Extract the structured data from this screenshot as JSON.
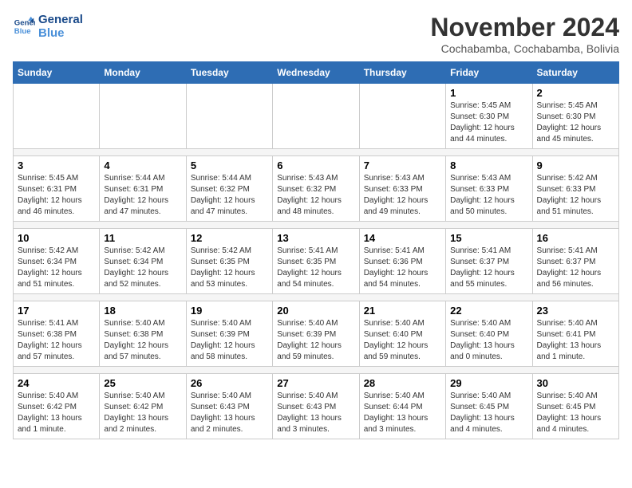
{
  "logo": {
    "line1": "General",
    "line2": "Blue"
  },
  "title": "November 2024",
  "subtitle": "Cochabamba, Cochabamba, Bolivia",
  "weekdays": [
    "Sunday",
    "Monday",
    "Tuesday",
    "Wednesday",
    "Thursday",
    "Friday",
    "Saturday"
  ],
  "weeks": [
    [
      {
        "day": "",
        "info": ""
      },
      {
        "day": "",
        "info": ""
      },
      {
        "day": "",
        "info": ""
      },
      {
        "day": "",
        "info": ""
      },
      {
        "day": "",
        "info": ""
      },
      {
        "day": "1",
        "info": "Sunrise: 5:45 AM\nSunset: 6:30 PM\nDaylight: 12 hours\nand 44 minutes."
      },
      {
        "day": "2",
        "info": "Sunrise: 5:45 AM\nSunset: 6:30 PM\nDaylight: 12 hours\nand 45 minutes."
      }
    ],
    [
      {
        "day": "3",
        "info": "Sunrise: 5:45 AM\nSunset: 6:31 PM\nDaylight: 12 hours\nand 46 minutes."
      },
      {
        "day": "4",
        "info": "Sunrise: 5:44 AM\nSunset: 6:31 PM\nDaylight: 12 hours\nand 47 minutes."
      },
      {
        "day": "5",
        "info": "Sunrise: 5:44 AM\nSunset: 6:32 PM\nDaylight: 12 hours\nand 47 minutes."
      },
      {
        "day": "6",
        "info": "Sunrise: 5:43 AM\nSunset: 6:32 PM\nDaylight: 12 hours\nand 48 minutes."
      },
      {
        "day": "7",
        "info": "Sunrise: 5:43 AM\nSunset: 6:33 PM\nDaylight: 12 hours\nand 49 minutes."
      },
      {
        "day": "8",
        "info": "Sunrise: 5:43 AM\nSunset: 6:33 PM\nDaylight: 12 hours\nand 50 minutes."
      },
      {
        "day": "9",
        "info": "Sunrise: 5:42 AM\nSunset: 6:33 PM\nDaylight: 12 hours\nand 51 minutes."
      }
    ],
    [
      {
        "day": "10",
        "info": "Sunrise: 5:42 AM\nSunset: 6:34 PM\nDaylight: 12 hours\nand 51 minutes."
      },
      {
        "day": "11",
        "info": "Sunrise: 5:42 AM\nSunset: 6:34 PM\nDaylight: 12 hours\nand 52 minutes."
      },
      {
        "day": "12",
        "info": "Sunrise: 5:42 AM\nSunset: 6:35 PM\nDaylight: 12 hours\nand 53 minutes."
      },
      {
        "day": "13",
        "info": "Sunrise: 5:41 AM\nSunset: 6:35 PM\nDaylight: 12 hours\nand 54 minutes."
      },
      {
        "day": "14",
        "info": "Sunrise: 5:41 AM\nSunset: 6:36 PM\nDaylight: 12 hours\nand 54 minutes."
      },
      {
        "day": "15",
        "info": "Sunrise: 5:41 AM\nSunset: 6:37 PM\nDaylight: 12 hours\nand 55 minutes."
      },
      {
        "day": "16",
        "info": "Sunrise: 5:41 AM\nSunset: 6:37 PM\nDaylight: 12 hours\nand 56 minutes."
      }
    ],
    [
      {
        "day": "17",
        "info": "Sunrise: 5:41 AM\nSunset: 6:38 PM\nDaylight: 12 hours\nand 57 minutes."
      },
      {
        "day": "18",
        "info": "Sunrise: 5:40 AM\nSunset: 6:38 PM\nDaylight: 12 hours\nand 57 minutes."
      },
      {
        "day": "19",
        "info": "Sunrise: 5:40 AM\nSunset: 6:39 PM\nDaylight: 12 hours\nand 58 minutes."
      },
      {
        "day": "20",
        "info": "Sunrise: 5:40 AM\nSunset: 6:39 PM\nDaylight: 12 hours\nand 59 minutes."
      },
      {
        "day": "21",
        "info": "Sunrise: 5:40 AM\nSunset: 6:40 PM\nDaylight: 12 hours\nand 59 minutes."
      },
      {
        "day": "22",
        "info": "Sunrise: 5:40 AM\nSunset: 6:40 PM\nDaylight: 13 hours\nand 0 minutes."
      },
      {
        "day": "23",
        "info": "Sunrise: 5:40 AM\nSunset: 6:41 PM\nDaylight: 13 hours\nand 1 minute."
      }
    ],
    [
      {
        "day": "24",
        "info": "Sunrise: 5:40 AM\nSunset: 6:42 PM\nDaylight: 13 hours\nand 1 minute."
      },
      {
        "day": "25",
        "info": "Sunrise: 5:40 AM\nSunset: 6:42 PM\nDaylight: 13 hours\nand 2 minutes."
      },
      {
        "day": "26",
        "info": "Sunrise: 5:40 AM\nSunset: 6:43 PM\nDaylight: 13 hours\nand 2 minutes."
      },
      {
        "day": "27",
        "info": "Sunrise: 5:40 AM\nSunset: 6:43 PM\nDaylight: 13 hours\nand 3 minutes."
      },
      {
        "day": "28",
        "info": "Sunrise: 5:40 AM\nSunset: 6:44 PM\nDaylight: 13 hours\nand 3 minutes."
      },
      {
        "day": "29",
        "info": "Sunrise: 5:40 AM\nSunset: 6:45 PM\nDaylight: 13 hours\nand 4 minutes."
      },
      {
        "day": "30",
        "info": "Sunrise: 5:40 AM\nSunset: 6:45 PM\nDaylight: 13 hours\nand 4 minutes."
      }
    ]
  ]
}
